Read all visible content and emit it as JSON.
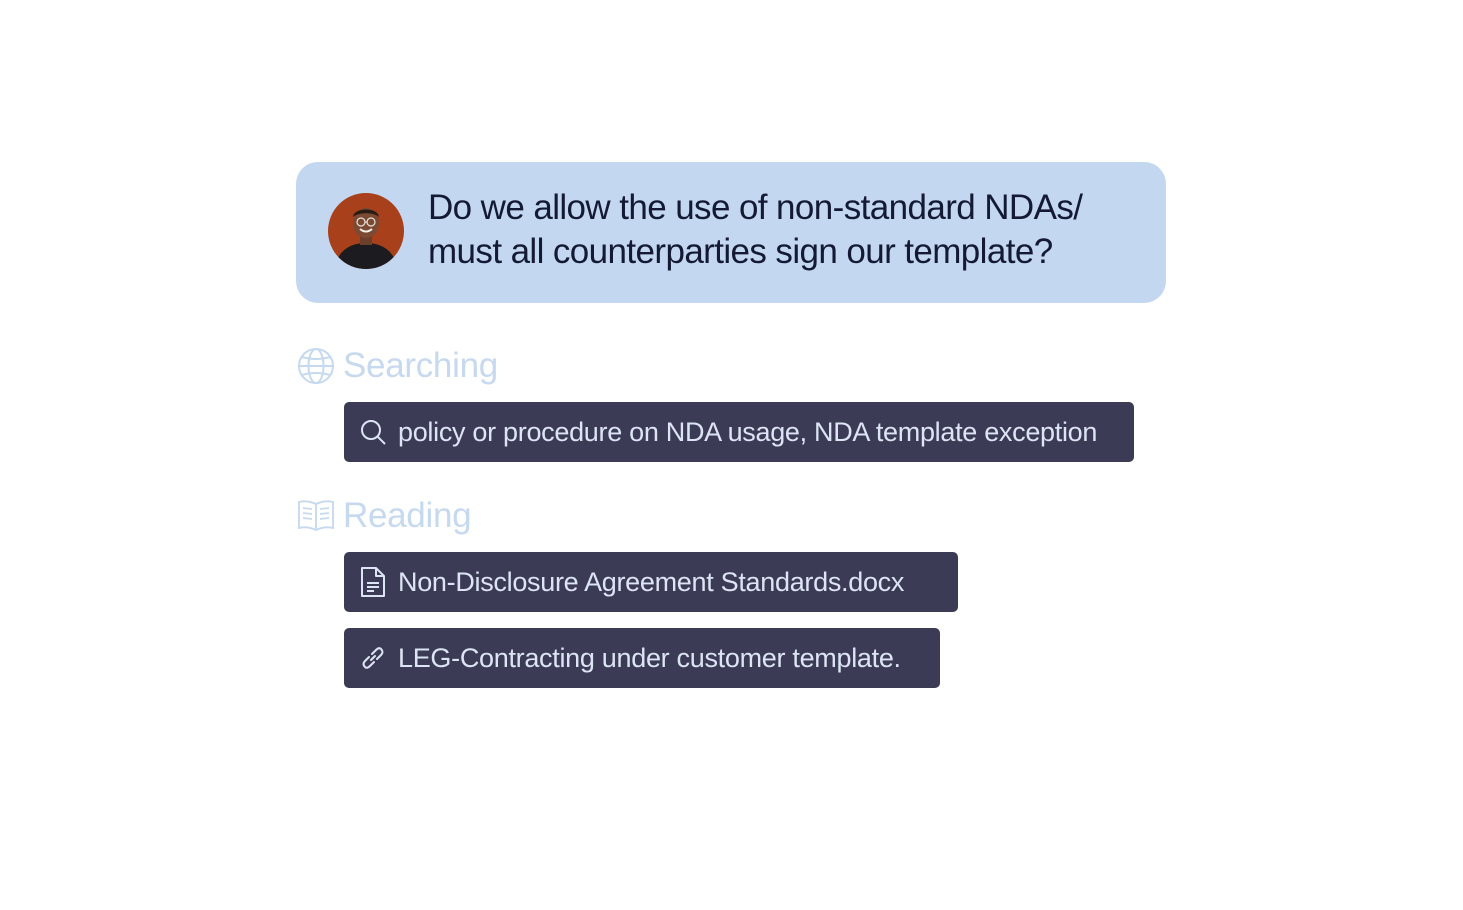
{
  "question": {
    "text": "Do we allow the use of non-standard NDAs/ must all counterparties sign our template?",
    "avatar": "user-avatar"
  },
  "searching": {
    "label": "Searching",
    "icon": "globe-icon",
    "query": {
      "icon": "search-icon",
      "text": "policy or procedure on NDA usage, NDA template exception"
    }
  },
  "reading": {
    "label": "Reading",
    "icon": "book-icon",
    "sources": [
      {
        "icon": "document-icon",
        "text": "Non-Disclosure Agreement Standards.docx"
      },
      {
        "icon": "link-icon",
        "text": "LEG-Contracting under customer template."
      }
    ]
  },
  "colors": {
    "question_bg": "#c3d7f0",
    "question_text": "#141a33",
    "section_label": "#c6d9ef",
    "chip_bg": "#3c3b55",
    "chip_text": "#dde4f5"
  }
}
